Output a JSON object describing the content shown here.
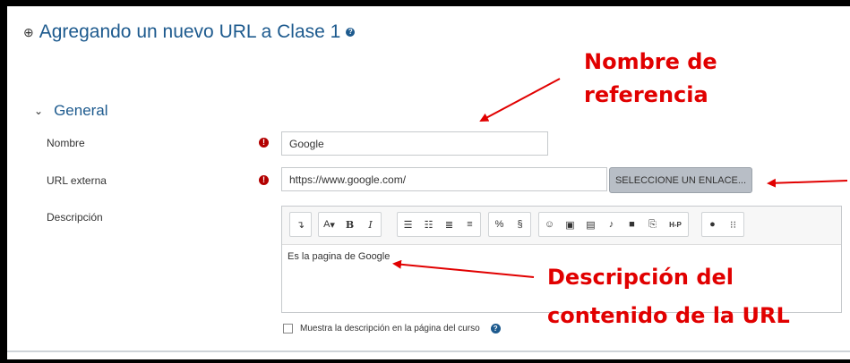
{
  "header": {
    "title": "Agregando un nuevo URL a Clase 1"
  },
  "section": {
    "label": "General"
  },
  "form": {
    "name_label": "Nombre",
    "name_value": "Google",
    "url_label": "URL externa",
    "url_value": "https://www.google.com/",
    "select_link_label": "SELECCIONE UN ENLACE...",
    "description_label": "Descripción",
    "description_text": "Es la pagina de Google",
    "show_description_label": "Muestra la descripción en la página del curso"
  },
  "toolbar": {
    "icons": [
      "insert-icon",
      "font-icon",
      "bold-icon",
      "italic-icon",
      "unordered-list-icon",
      "ordered-list-icon",
      "outdent-icon",
      "indent-icon",
      "link-icon",
      "unlink-icon",
      "emoji-icon",
      "image-icon",
      "media-icon",
      "record-audio-icon",
      "record-video-icon",
      "manage-files-icon",
      "h5p-icon",
      "accessibility-checker-icon",
      "screenreader-helper-icon"
    ],
    "bold": "B",
    "italic": "I",
    "font": "A",
    "h5p": "H-P"
  },
  "annotations": {
    "name_ref_line1": "Nombre de",
    "name_ref_line2": "referencia",
    "desc_line1": "Descripción del",
    "desc_line2": "contenido de la URL"
  },
  "colors": {
    "title": "#1d5a8e",
    "required": "#b30000",
    "annotation": "#e10000"
  }
}
